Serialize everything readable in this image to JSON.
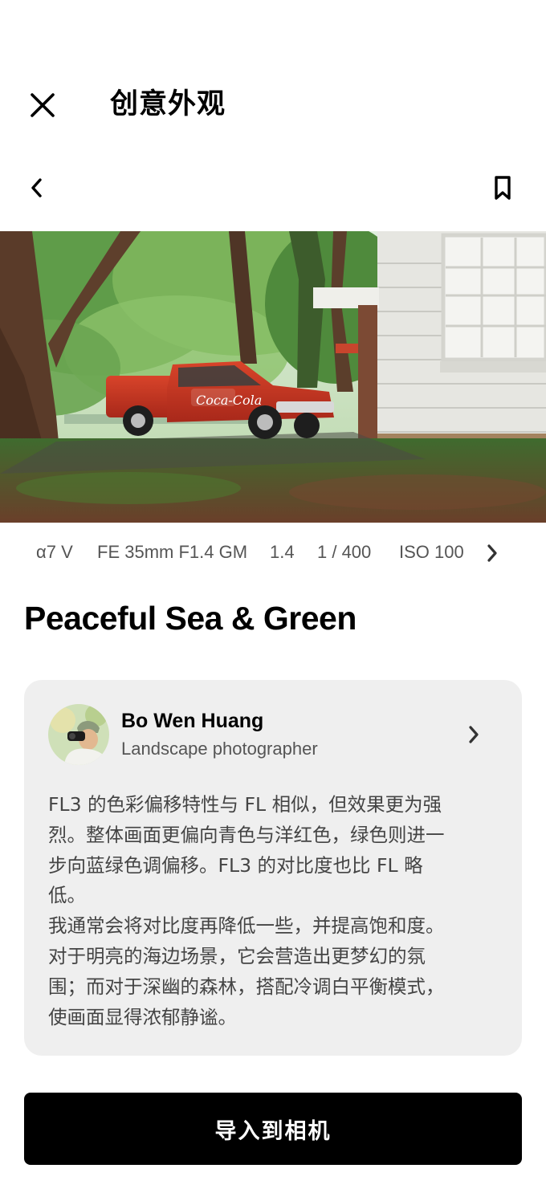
{
  "header": {
    "title": "创意外观",
    "close_icon": "close-icon"
  },
  "subnav": {
    "back_icon": "chevron-left-icon",
    "bookmark_icon": "bookmark-icon"
  },
  "photo": {
    "subject": "red pickup truck",
    "logo_text": "Coca-Cola"
  },
  "exif": {
    "camera": "α7 V",
    "lens": "FE 35mm F1.4 GM",
    "aperture": "1.4",
    "shutter": "1 / 400",
    "iso": "ISO 100",
    "next_icon": "chevron-right-icon"
  },
  "look": {
    "title": "Peaceful Sea & Green"
  },
  "author": {
    "name": "Bo Wen Huang",
    "role": "Landscape photographer",
    "chevron_icon": "chevron-right-icon"
  },
  "description": {
    "lines": [
      "FL3 的色彩偏移特性与 FL 相似，但效果更为强",
      "烈。整体画面更偏向青色与洋红色，绿色则进一",
      "步向蓝绿色调偏移。FL3 的对比度也比 FL 略",
      "低。",
      "我通常会将对比度再降低一些，并提高饱和度。",
      "对于明亮的海边场景，它会营造出更梦幻的氛",
      "围；而对于深幽的森林，搭配冷调白平衡模式，",
      "使画面显得浓郁静谧。"
    ]
  },
  "actions": {
    "import_label": "导入到相机"
  },
  "colors": {
    "primary_button": "#000000",
    "card_background": "#efefef",
    "truck_red": "#c8321e"
  }
}
